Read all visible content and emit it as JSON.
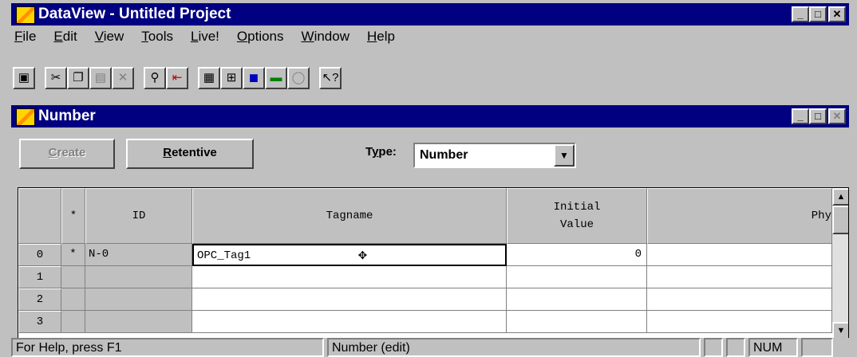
{
  "app": {
    "title": "DataView - Untitled Project"
  },
  "menu": [
    {
      "pre": "",
      "u": "F",
      "post": "ile"
    },
    {
      "pre": "",
      "u": "E",
      "post": "dit"
    },
    {
      "pre": "",
      "u": "V",
      "post": "iew"
    },
    {
      "pre": "",
      "u": "T",
      "post": "ools"
    },
    {
      "pre": "",
      "u": "L",
      "post": "ive!"
    },
    {
      "pre": "",
      "u": "O",
      "post": "ptions"
    },
    {
      "pre": "",
      "u": "W",
      "post": "indow"
    },
    {
      "pre": "",
      "u": "H",
      "post": "elp"
    }
  ],
  "toolbar_icons": [
    "save-icon",
    "cut-icon",
    "copy-icon",
    "paste-icon",
    "delete-icon",
    "find-icon",
    "replace-icon",
    "window-icon",
    "hierarchy-icon",
    "objects-icon",
    "tag-icon",
    "search-icon",
    "help-pointer-icon"
  ],
  "child": {
    "title": "Number"
  },
  "buttons": {
    "create": {
      "u": "C",
      "rest": "reate"
    },
    "retentive": {
      "u": "R",
      "rest": "etentive"
    }
  },
  "type": {
    "label_pre": "T",
    "label_u": "y",
    "label_post": "pe:",
    "value": "Number"
  },
  "grid": {
    "headers": {
      "marker": "*",
      "id": "ID",
      "tagname": "Tagname",
      "initial_value_line1": "Initial",
      "initial_value_line2": "Value",
      "phy": "Phy"
    },
    "rows": [
      {
        "num": "0",
        "marker": "*",
        "id": "N-0",
        "tagname": "OPC_Tag1",
        "value": "0"
      },
      {
        "num": "1",
        "marker": "",
        "id": "",
        "tagname": "",
        "value": ""
      },
      {
        "num": "2",
        "marker": "",
        "id": "",
        "tagname": "",
        "value": ""
      },
      {
        "num": "3",
        "marker": "",
        "id": "",
        "tagname": "",
        "value": ""
      }
    ]
  },
  "statusbar": {
    "help": "For Help, press F1",
    "mode": "Number (edit)",
    "num": "NUM"
  }
}
